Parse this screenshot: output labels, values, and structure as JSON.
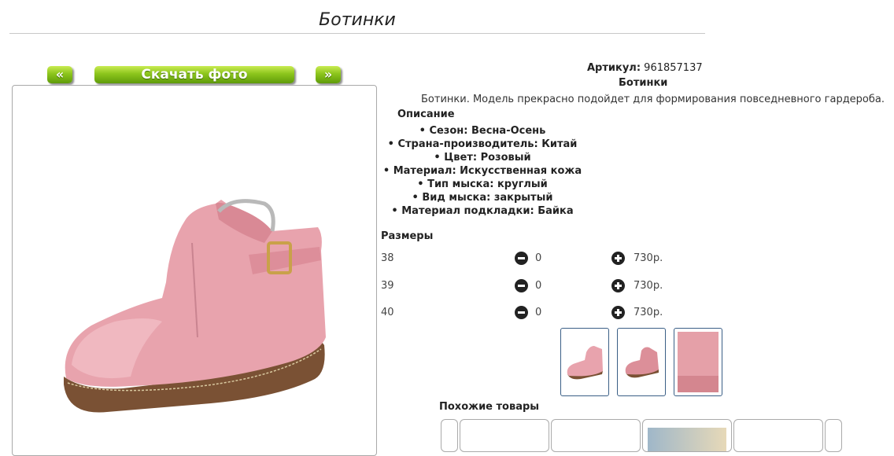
{
  "page": {
    "title": "Ботинки"
  },
  "gallery": {
    "prev_label": "«",
    "download_label": "Скачать фото",
    "next_label": "»"
  },
  "product": {
    "article_label": "Артикул:",
    "article_value": "961857137",
    "name": "Ботинки",
    "description": "Ботинки. Модель прекрасно подойдет для формирования повседневного гардероба.",
    "description_heading": "Описание",
    "features": [
      "Сезон: Весна-Осень",
      "Страна-производитель: Китай",
      "Цвет: Розовый",
      "Материал: Искусственная кожа",
      "Тип мыска: круглый",
      "Вид мыска: закрытый",
      "Материал подкладки: Байка"
    ]
  },
  "sizes": {
    "heading": "Размеры",
    "rows": [
      {
        "size": "38",
        "qty": "0",
        "price": "730р."
      },
      {
        "size": "39",
        "qty": "0",
        "price": "730р."
      },
      {
        "size": "40",
        "qty": "0",
        "price": "730р."
      }
    ]
  },
  "similar": {
    "heading": "Похожие товары"
  },
  "icons": {
    "minus": "minus-circle-icon",
    "plus": "plus-circle-icon"
  },
  "colors": {
    "button_green": "#8cc51c",
    "thumb_border": "#3a5f86",
    "boot_pink": "#e8a3ad"
  }
}
